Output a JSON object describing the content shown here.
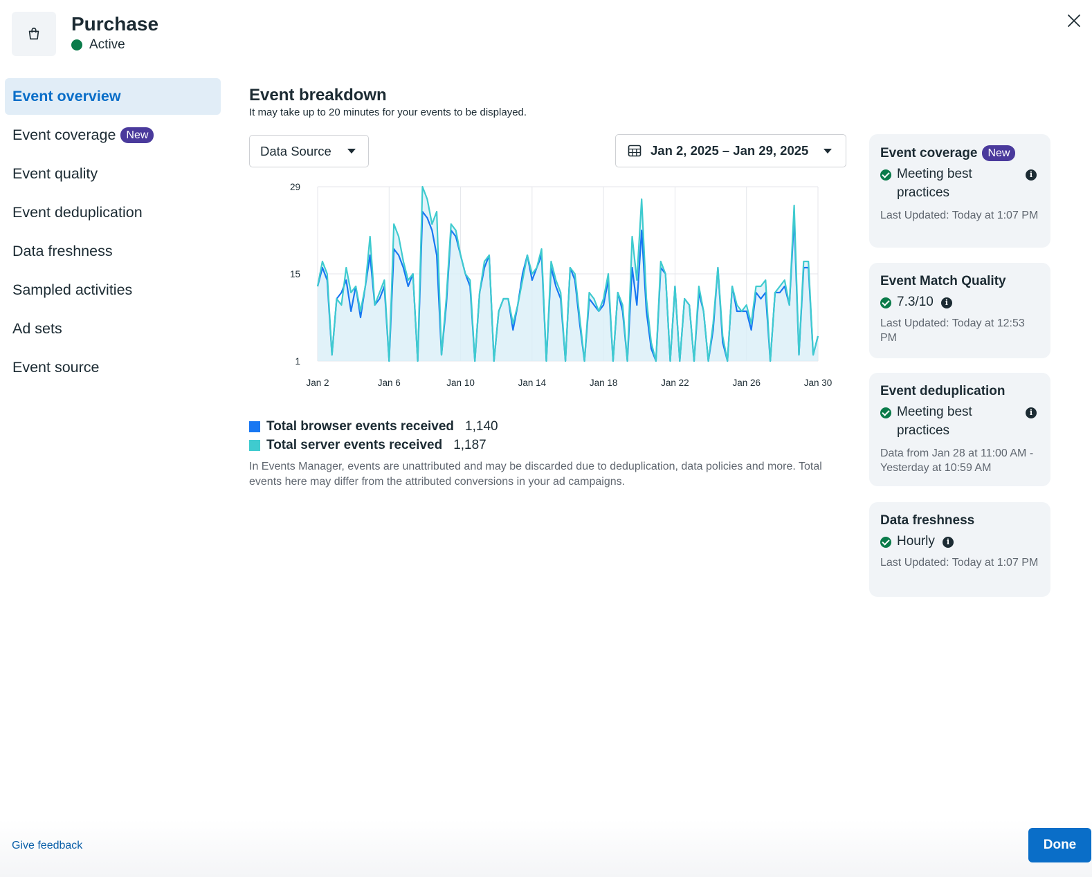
{
  "header": {
    "icon": "shopping-bag-icon",
    "title": "Purchase",
    "status": "Active",
    "status_color": "#0a7b4a"
  },
  "sidebar": {
    "items": [
      {
        "label": "Event overview",
        "active": true
      },
      {
        "label": "Event coverage",
        "badge": "New"
      },
      {
        "label": "Event quality"
      },
      {
        "label": "Event deduplication"
      },
      {
        "label": "Data freshness"
      },
      {
        "label": "Sampled activities"
      },
      {
        "label": "Ad sets"
      },
      {
        "label": "Event source"
      }
    ]
  },
  "main": {
    "title": "Event breakdown",
    "subtitle": "It may take up to 20 minutes for your events to be displayed.",
    "data_source_label": "Data Source",
    "date_range": "Jan 2, 2025 – Jan 29, 2025",
    "legend": [
      {
        "label": "Total browser events received",
        "value": "1,140",
        "color": "#1877f2"
      },
      {
        "label": "Total server events received",
        "value": "1,187",
        "color": "#3fcbcf"
      }
    ],
    "disclaimer": "In Events Manager, events are unattributed and may be discarded due to deduplication, data policies and more. Total events here may differ from the attributed conversions in your ad campaigns."
  },
  "chart_data": {
    "type": "area",
    "title": "",
    "xlabel": "",
    "ylabel": "",
    "ylim": [
      1,
      29
    ],
    "yticks": [
      "29",
      "15",
      "1"
    ],
    "xlim": [
      0,
      28
    ],
    "xticks": [
      "Jan 2",
      "Jan 6",
      "Jan 10",
      "Jan 14",
      "Jan 18",
      "Jan 22",
      "Jan 26",
      "Jan 30"
    ],
    "grid": true,
    "x_unit": "days from Jan 2 (hourly samples)",
    "series": [
      {
        "name": "Total browser events received",
        "color": "#1877f2",
        "values": [
          13,
          16,
          14,
          2,
          11,
          12,
          14,
          9,
          13,
          8,
          13,
          18,
          10,
          11,
          13,
          1,
          19,
          18,
          16,
          13,
          15,
          1,
          25,
          24,
          22,
          18,
          2,
          10,
          22,
          21,
          18,
          15,
          13,
          1,
          12,
          16,
          18,
          1,
          9,
          11,
          11,
          6,
          10,
          15,
          18,
          14,
          16,
          18,
          1,
          16,
          13,
          11,
          1,
          16,
          14,
          7,
          1,
          11,
          10,
          9,
          10,
          14,
          1,
          12,
          9,
          1,
          16,
          10,
          22,
          9,
          3,
          1,
          16,
          15,
          1,
          13,
          1,
          11,
          10,
          1,
          12,
          9,
          1,
          6,
          16,
          4,
          1,
          13,
          9,
          9,
          9,
          6,
          12,
          11,
          12,
          1,
          12,
          12,
          13,
          10,
          24,
          2,
          16,
          16,
          2,
          5
        ]
      },
      {
        "name": "Total server events received",
        "color": "#3fcbcf",
        "values": [
          13,
          17,
          15,
          2,
          11,
          10,
          16,
          12,
          13,
          9,
          13,
          21,
          10,
          12,
          14,
          1,
          23,
          21,
          17,
          14,
          15,
          1,
          29,
          27,
          23,
          25,
          2,
          11,
          23,
          22,
          18,
          15,
          14,
          1,
          12,
          17,
          18,
          1,
          9,
          11,
          11,
          7,
          10,
          14,
          18,
          15,
          16,
          19,
          1,
          17,
          14,
          12,
          1,
          16,
          15,
          8,
          1,
          12,
          11,
          9,
          11,
          15,
          1,
          12,
          10,
          1,
          21,
          14,
          27,
          11,
          4,
          1,
          17,
          15,
          1,
          13,
          1,
          11,
          10,
          1,
          13,
          9,
          1,
          7,
          16,
          5,
          1,
          13,
          10,
          9,
          10,
          7,
          13,
          13,
          14,
          1,
          12,
          13,
          14,
          10,
          26,
          2,
          17,
          17,
          2,
          5
        ]
      }
    ]
  },
  "cards": [
    {
      "title": "Event coverage",
      "badge": "New",
      "status": "Meeting best practices",
      "meta": "Last Updated: Today at 1:07 PM"
    },
    {
      "title": "Event Match Quality",
      "status": "7.3/10",
      "meta": "Last Updated: Today at 12:53 PM"
    },
    {
      "title": "Event deduplication",
      "status": "Meeting best practices",
      "meta": "Data from Jan 28 at 11:00 AM - Yesterday at 10:59 AM"
    },
    {
      "title": "Data freshness",
      "status": "Hourly",
      "meta": "Last Updated: Today at 1:07 PM"
    }
  ],
  "footer": {
    "feedback_label": "Give feedback",
    "done_label": "Done"
  }
}
